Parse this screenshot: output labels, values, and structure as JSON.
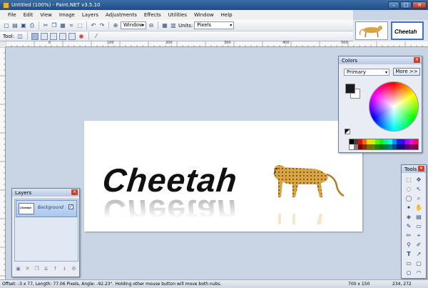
{
  "window": {
    "title": "Untitled (100%) - Paint.NET v3.5.10"
  },
  "menu": [
    "File",
    "Edit",
    "View",
    "Image",
    "Layers",
    "Adjustments",
    "Effects",
    "Utilities",
    "Window",
    "Help"
  ],
  "toolbar": {
    "zoom_value": "Window",
    "units_label": "Units:",
    "units_value": "Pixels",
    "tool_label": "Tool:"
  },
  "thumbnails": {
    "second_label": "Cheetah"
  },
  "rulers": {
    "ticks": [
      "0",
      "100",
      "200",
      "300",
      "400",
      "500"
    ]
  },
  "canvas": {
    "text": "Cheetah"
  },
  "colors": {
    "title": "Colors",
    "mode_value": "Primary",
    "more_label": "More >>",
    "palette": [
      "#000000",
      "#404040",
      "#ff0000",
      "#ff6a00",
      "#ffd800",
      "#b6ff00",
      "#4cff00",
      "#00ff21",
      "#00ff90",
      "#00ffff",
      "#0094ff",
      "#0026ff",
      "#4800ff",
      "#b200ff",
      "#ff00dc",
      "#ff006e",
      "#ffffff",
      "#808080",
      "#7f0000",
      "#7f3300",
      "#7f6a00",
      "#5b7f00",
      "#267f00",
      "#007f0e",
      "#007f46",
      "#007f7f",
      "#004a7f",
      "#00137f",
      "#21007f",
      "#57007f",
      "#7f006e",
      "#7f0037"
    ]
  },
  "tools": {
    "title": "Tools"
  },
  "layers": {
    "title": "Layers",
    "layer_name": "Background"
  },
  "status": {
    "message": "Offset: -3 x 77, Length: 77.06 Pixels, Angle: -92.23°. Holding other mouse button will move both nubs.",
    "size": "700 x 150",
    "position": "234, 272"
  }
}
